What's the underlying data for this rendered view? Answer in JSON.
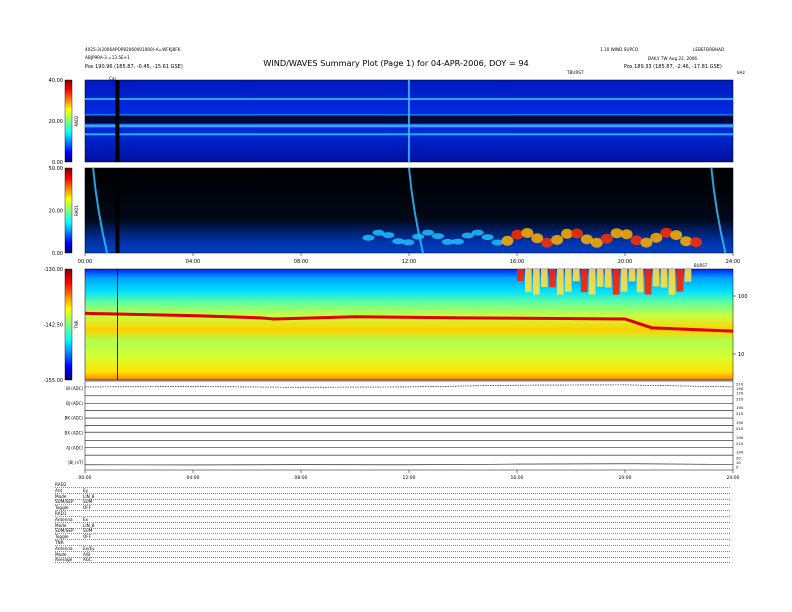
{
  "header": {
    "title": "WIND/WAVES Summary Plot (Page 1) for 04-APR-2006, DOY = 94",
    "left_line1": "4025-3(2006APOP82060001000)-A=WFKJ8FK",
    "left_line2": "ABJP9RA-3 =13.5E+1",
    "left_position": "Pos 190.96 (185.87, -0.45, -15.61 GSE)",
    "right_line1": "1.10 WIND SUPCO",
    "right_line2": "LEBEFORBHAD",
    "right_line3": "DAILY TW Aug 22, 2006",
    "right_position": "Pos 189.33 (185.87, -2.46, -17.81 GSE)",
    "top_marker": "TBURST",
    "cal_marker": "Cal",
    "corner_label": "kHz"
  },
  "chart_data": [
    {
      "type": "heatmap",
      "panel": "RAD2",
      "ylabel": "RAD2",
      "colorbar_ticks": [
        "40.00",
        "20.00",
        "0.00"
      ],
      "colorbar_range": [
        0,
        40
      ],
      "x_range_hours": [
        0,
        24
      ],
      "features": [
        {
          "kind": "horizontal_band",
          "level": "high",
          "y_fraction": 0.78
        },
        {
          "kind": "horizontal_band",
          "level": "high",
          "y_fraction": 0.58
        },
        {
          "kind": "horizontal_band",
          "level": "high",
          "y_fraction": 0.35
        },
        {
          "kind": "dark_band",
          "y_fraction": 0.52
        },
        {
          "kind": "vertical_burst",
          "hour": 12.0
        },
        {
          "kind": "data_gap",
          "hour": 1.2
        }
      ]
    },
    {
      "type": "heatmap",
      "panel": "RAD1",
      "ylabel": "RAD1",
      "colorbar_ticks": [
        "50.00",
        "20.00",
        "0.00"
      ],
      "colorbar_range": [
        0,
        50
      ],
      "x_ticks": [
        "00:00",
        "04:00",
        "08:00",
        "12:00",
        "16:00",
        "20:00",
        "24:00"
      ],
      "x_range_hours": [
        0,
        24
      ],
      "features": [
        {
          "kind": "type_iii_burst",
          "hour": 12.0
        },
        {
          "kind": "type_iii_burst",
          "hour": 0.3
        },
        {
          "kind": "type_iii_burst",
          "hour": 23.2
        },
        {
          "kind": "emission_patches",
          "start_hour": 10.5,
          "end_hour": 23.0,
          "level": "high"
        },
        {
          "kind": "data_gap",
          "hour": 1.2
        }
      ]
    },
    {
      "type": "heatmap",
      "panel": "TNR",
      "ylabel": "TNR",
      "colorbar_ticks": [
        "-130.00",
        "-142.50",
        "-155.00"
      ],
      "colorbar_range": [
        -155,
        -130
      ],
      "right_axis_ticks": [
        "100",
        "10"
      ],
      "x_range_hours": [
        0,
        24
      ],
      "features": [
        {
          "kind": "plasma_line",
          "hours": [
            0,
            4,
            6.5,
            7,
            10,
            14,
            20,
            21,
            24
          ],
          "y_fraction": [
            0.6,
            0.58,
            0.56,
            0.55,
            0.57,
            0.56,
            0.55,
            0.47,
            0.44
          ]
        },
        {
          "kind": "burst_upper",
          "start_hour": 16.0,
          "end_hour": 22.5
        },
        {
          "kind": "data_gap",
          "hour": 1.2
        }
      ],
      "annotation": "BURST"
    },
    {
      "type": "line",
      "panel": "housekeeping",
      "x_ticks": [
        "00:00",
        "04:00",
        "08:00",
        "12:00",
        "16:00",
        "20:00",
        "24:00"
      ],
      "x_range_hours": [
        0,
        24
      ],
      "series": [
        {
          "name": "BI (ADC)",
          "right_ticks": [
            "210",
            "190",
            "170"
          ],
          "x": [
            0,
            4,
            8,
            12,
            16,
            20,
            24
          ],
          "values": [
            0.6,
            0.62,
            0.58,
            0.6,
            0.72,
            0.74,
            0.6
          ]
        },
        {
          "name": "BJ (ADC)",
          "right_ticks": [
            "210",
            "190"
          ],
          "x": [
            0,
            24
          ],
          "values": [
            0.5,
            0.5
          ]
        },
        {
          "name": "BK (ADC)",
          "right_ticks": [
            "210",
            "190"
          ],
          "x": [
            0,
            24
          ],
          "values": [
            0.5,
            0.5
          ]
        },
        {
          "name": "BX (ADC)",
          "right_ticks": [
            "210",
            "190"
          ],
          "x": [
            0,
            24
          ],
          "values": [
            0.55,
            0.55
          ]
        },
        {
          "name": "AJ (ADC)",
          "right_ticks": [
            "210",
            "190"
          ],
          "x": [
            0,
            24
          ],
          "values": [
            0.5,
            0.5
          ]
        },
        {
          "name": "|B| (nT)",
          "right_ticks": [
            "20",
            "10",
            "0"
          ],
          "x": [
            0,
            4,
            8,
            12,
            16,
            20,
            24
          ],
          "values": [
            0.35,
            0.34,
            0.36,
            0.35,
            0.4,
            0.42,
            0.38
          ]
        }
      ]
    }
  ],
  "footer": {
    "rows": [
      {
        "label": "RAD2",
        "value": ""
      },
      {
        "label": "Ant",
        "value": "Ey"
      },
      {
        "label": "Mode",
        "value": "LIN_8"
      },
      {
        "label": "SUM/SEP",
        "value": "SUM"
      },
      {
        "label": "Toggle",
        "value": "OFF"
      },
      {
        "label": "RAD1",
        "value": ""
      },
      {
        "label": "Antenna",
        "value": "Ex"
      },
      {
        "label": "Mode",
        "value": "LIN_8"
      },
      {
        "label": "SUM/SEP",
        "value": "SUM"
      },
      {
        "label": "Toggle",
        "value": "OFF"
      },
      {
        "label": "TNR",
        "value": ""
      },
      {
        "label": "Antenna",
        "value": "Ex/Ey"
      },
      {
        "label": "Mode",
        "value": "A/B"
      },
      {
        "label": "Average",
        "value": "AGC"
      }
    ]
  }
}
